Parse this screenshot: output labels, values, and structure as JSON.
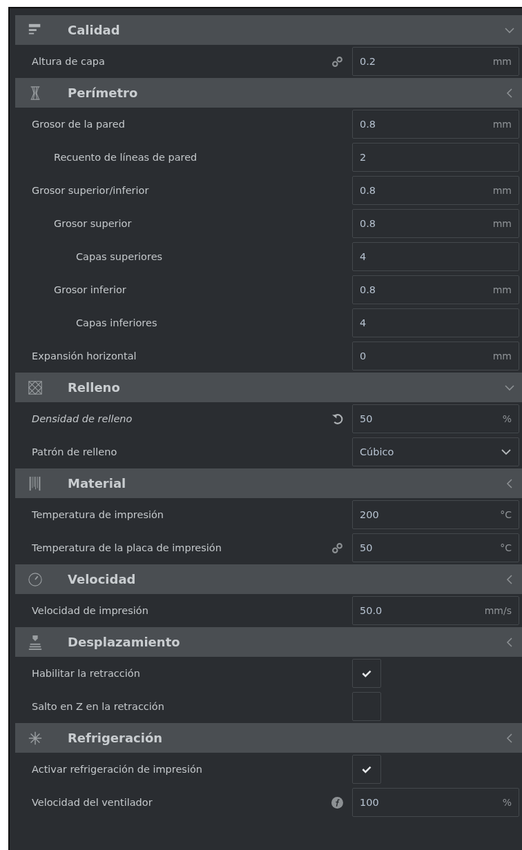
{
  "sections": [
    {
      "title": "Calidad",
      "kind": "quality",
      "expanded": true,
      "settings": [
        {
          "label": "Altura de capa",
          "italic": false,
          "kind": "linked",
          "control": {
            "kind": "number",
            "value": "0.2",
            "unit": "mm"
          }
        }
      ]
    },
    {
      "title": "Perímetro",
      "kind": "shell",
      "expanded": false,
      "settings": [
        {
          "label": "Grosor de la pared",
          "italic": false,
          "control": {
            "kind": "number",
            "value": "0.8",
            "unit": "mm"
          },
          "children": [
            {
              "label": "Recuento de líneas de pared",
              "italic": false,
              "control": {
                "kind": "number",
                "value": "2"
              }
            }
          ]
        },
        {
          "label": "Grosor superior/inferior",
          "italic": false,
          "control": {
            "kind": "number",
            "value": "0.8",
            "unit": "mm"
          },
          "children": [
            {
              "label": "Grosor superior",
              "italic": false,
              "control": {
                "kind": "number",
                "value": "0.8",
                "unit": "mm"
              },
              "children": [
                {
                  "label": "Capas superiores",
                  "italic": false,
                  "control": {
                    "kind": "number",
                    "value": "4"
                  }
                }
              ]
            },
            {
              "label": "Grosor inferior",
              "italic": false,
              "control": {
                "kind": "number",
                "value": "0.8",
                "unit": "mm"
              },
              "children": [
                {
                  "label": "Capas inferiores",
                  "italic": false,
                  "control": {
                    "kind": "number",
                    "value": "4"
                  }
                }
              ]
            }
          ]
        },
        {
          "label": "Expansión horizontal",
          "italic": false,
          "control": {
            "kind": "number",
            "value": "0",
            "unit": "mm"
          }
        }
      ]
    },
    {
      "title": "Relleno",
      "kind": "infill",
      "expanded": true,
      "settings": [
        {
          "label": "Densidad de relleno",
          "italic": true,
          "kind": "reset",
          "control": {
            "kind": "number",
            "value": "50",
            "unit": "%"
          }
        },
        {
          "label": "Patrón de relleno",
          "italic": false,
          "control": {
            "kind": "dropdown",
            "value": "Cúbico"
          }
        }
      ]
    },
    {
      "title": "Material",
      "kind": "material",
      "expanded": false,
      "settings": [
        {
          "label": "Temperatura de impresión",
          "italic": false,
          "control": {
            "kind": "number",
            "value": "200",
            "unit": "°C"
          }
        },
        {
          "label": "Temperatura de la placa de impresión",
          "italic": false,
          "kind": "linked",
          "control": {
            "kind": "number",
            "value": "50",
            "unit": "°C"
          }
        }
      ]
    },
    {
      "title": "Velocidad",
      "kind": "speed",
      "expanded": false,
      "settings": [
        {
          "label": "Velocidad de impresión",
          "italic": false,
          "control": {
            "kind": "number",
            "value": "50.0",
            "unit": "mm/s"
          }
        }
      ]
    },
    {
      "title": "Desplazamiento",
      "kind": "travel",
      "expanded": false,
      "settings": [
        {
          "label": "Habilitar la retracción",
          "italic": false,
          "control": {
            "kind": "checkbox",
            "checked": true
          }
        },
        {
          "label": "Salto en Z en la retracción",
          "italic": false,
          "control": {
            "kind": "checkbox",
            "checked": false
          }
        }
      ]
    },
    {
      "title": "Refrigeración",
      "kind": "cooling",
      "expanded": false,
      "settings": [
        {
          "label": "Activar refrigeración de impresión",
          "italic": false,
          "control": {
            "kind": "checkbox",
            "checked": true
          }
        },
        {
          "label": "Velocidad del ventilador",
          "italic": false,
          "kind": "function",
          "control": {
            "kind": "number",
            "value": "100",
            "unit": "%"
          }
        }
      ]
    }
  ]
}
